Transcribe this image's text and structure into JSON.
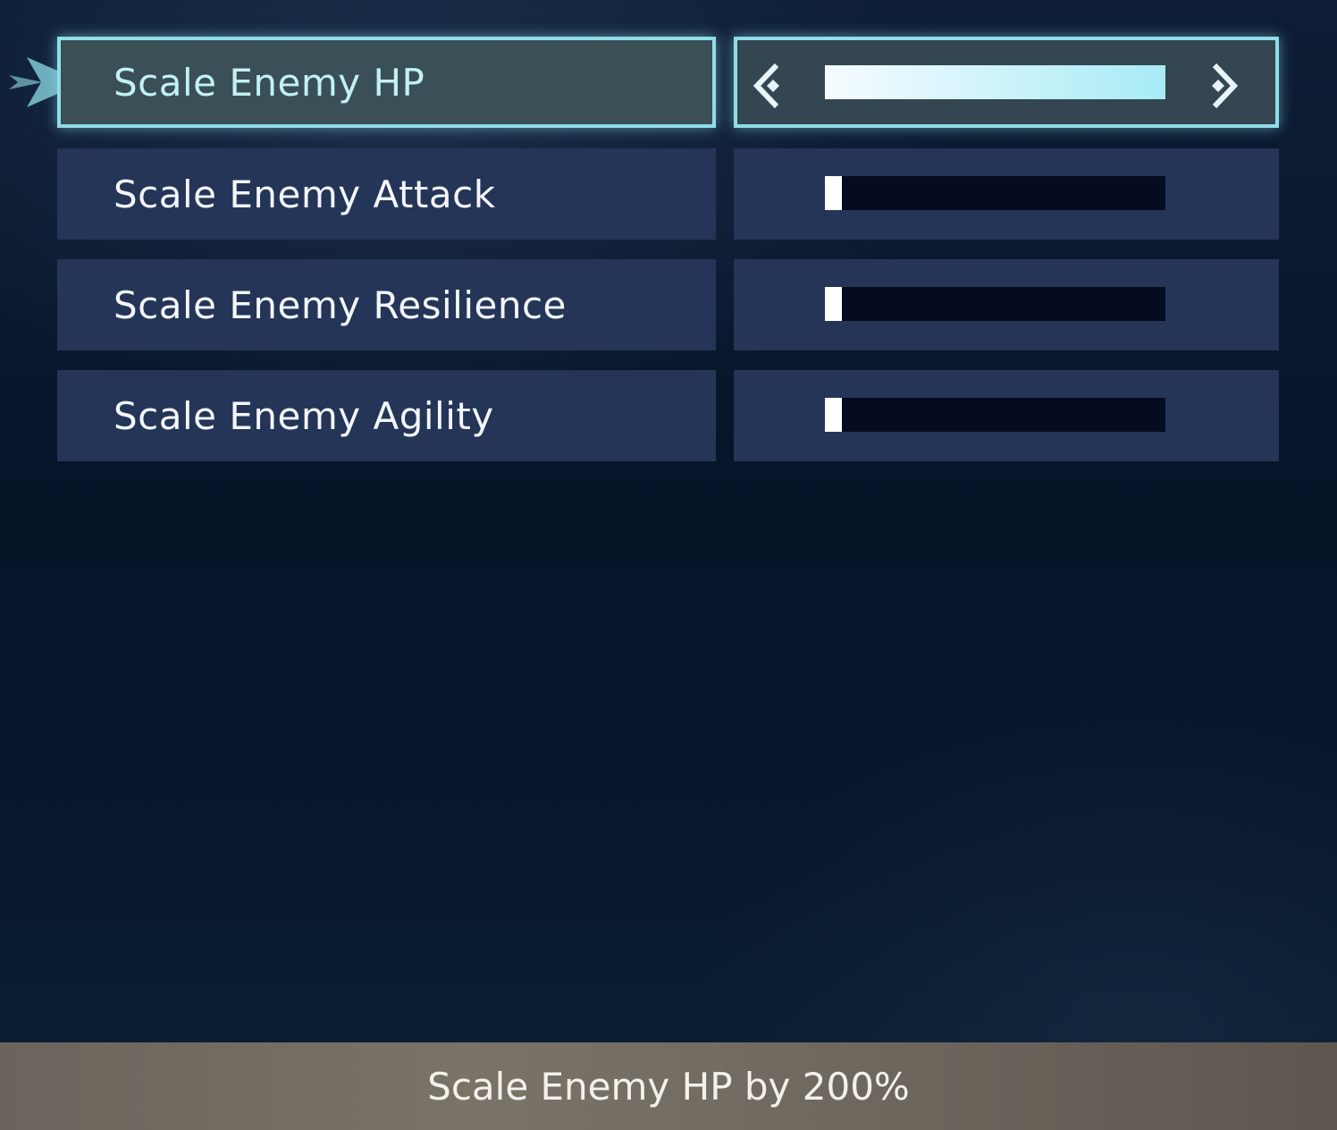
{
  "menu": {
    "selected_index": 0,
    "items": [
      {
        "label": "Scale Enemy HP",
        "level": 1.0
      },
      {
        "label": "Scale Enemy Attack",
        "level": 0.05
      },
      {
        "label": "Scale Enemy Resilience",
        "level": 0.05
      },
      {
        "label": "Scale Enemy Agility",
        "level": 0.05
      }
    ]
  },
  "footer": {
    "description": "Scale Enemy HP by 200%"
  },
  "colors": {
    "selected_border": "#8fdde8",
    "row_background": "#243558",
    "bar_track": "#060c20"
  },
  "icons": {
    "cursor": "selection-cursor-icon",
    "decrease": "arrow-left-icon",
    "increase": "arrow-right-icon"
  }
}
